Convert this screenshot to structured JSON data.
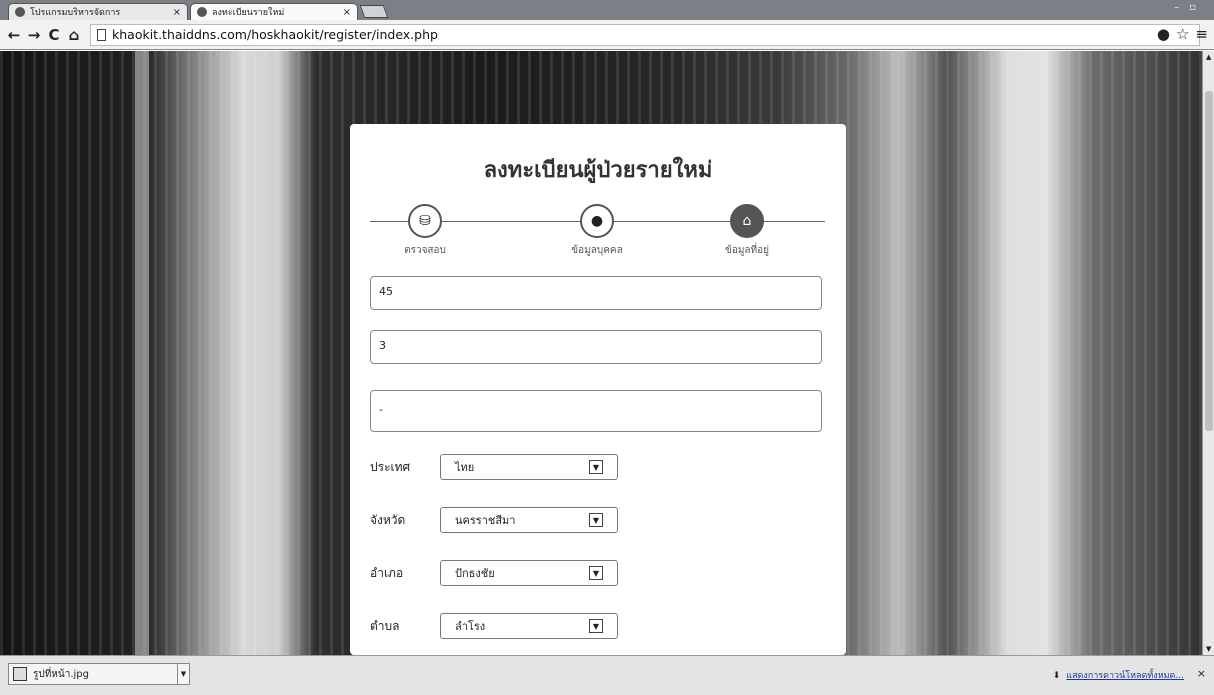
{
  "browser": {
    "tabs": [
      {
        "label": "โปรแกรมบริหารจัดการ",
        "active": false
      },
      {
        "label": "ลงทะเบียนรายใหม่",
        "active": true
      }
    ],
    "url": "khaokit.thaiddns.com/hoskhaokit/register/index.php"
  },
  "page": {
    "title": "ลงทะเบียนผู้ป่วยรายใหม่",
    "steps": [
      {
        "label": "ตรวจสอบ",
        "icon": "database-icon",
        "active": false
      },
      {
        "label": "ข้อมูลบุคคล",
        "icon": "user-icon",
        "active": false
      },
      {
        "label": "ข้อมูลที่อยู่",
        "icon": "home-icon",
        "active": true
      }
    ],
    "fields": {
      "house_no": "45",
      "moo": "3",
      "road": "-"
    },
    "selects": [
      {
        "label": "ประเทศ",
        "value": "ไทย"
      },
      {
        "label": "จังหวัด",
        "value": "นครราชสีมา"
      },
      {
        "label": "อำเภอ",
        "value": "ปักธงชัย"
      },
      {
        "label": "ตำบล",
        "value": "ลำโรง"
      }
    ]
  },
  "downloads": {
    "file_name": "รูปที่หน้า.jpg",
    "show_all": "แสดงการดาวน์โหลดทั้งหมด..."
  },
  "colors": {
    "tabbar": "#7b7f86",
    "card": "#ffffff",
    "step_active": "#555555"
  }
}
